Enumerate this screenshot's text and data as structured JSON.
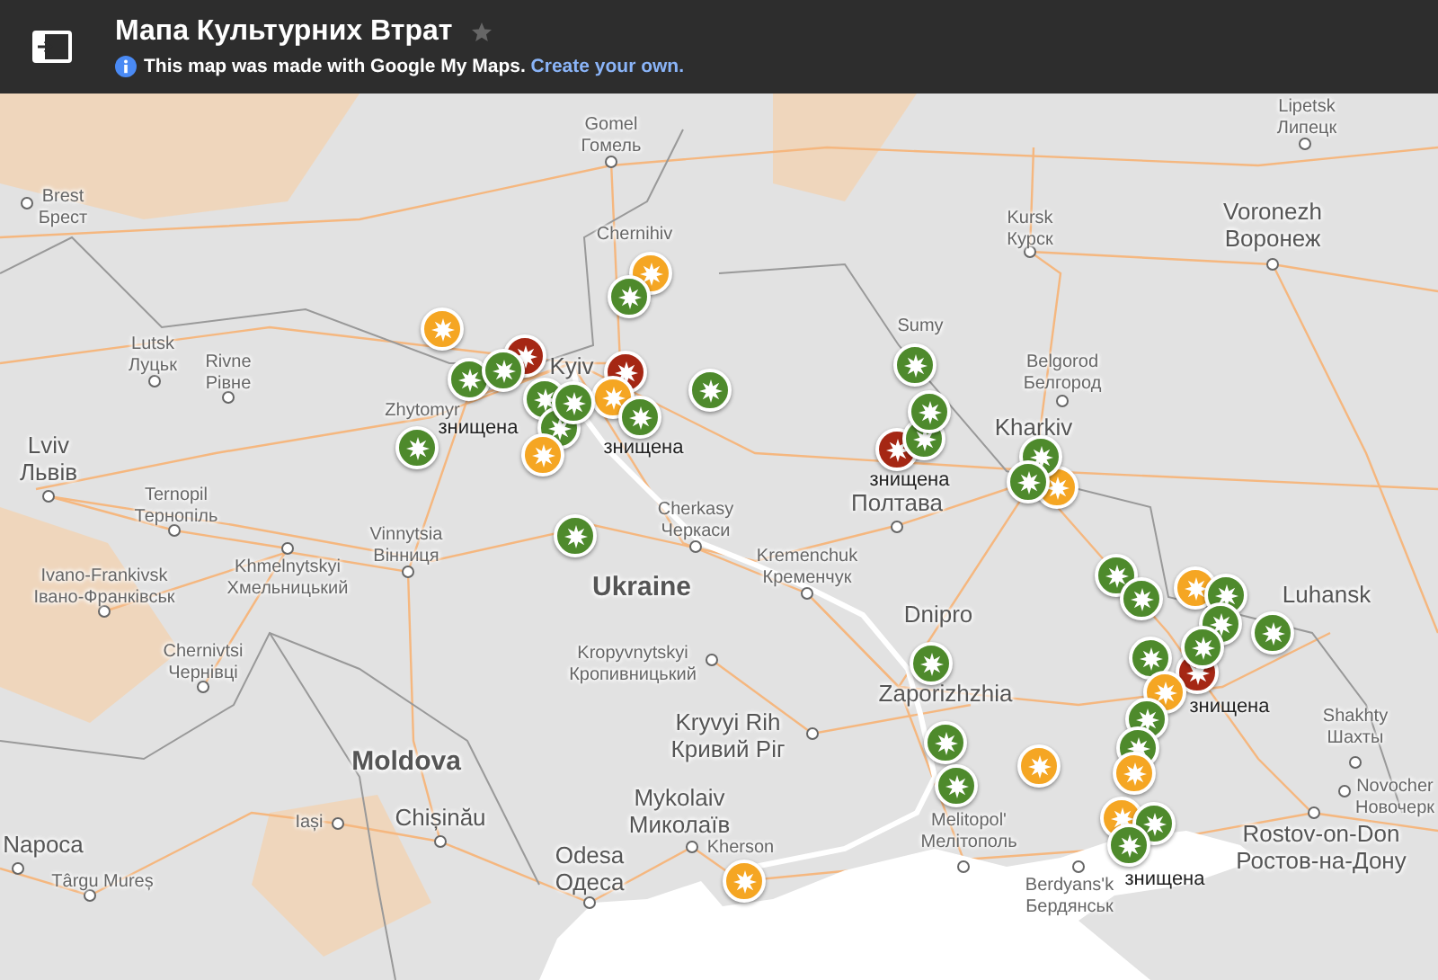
{
  "header": {
    "title": "Мапа Культурних Втрат",
    "info": "This map was made with Google My Maps.",
    "link": "Create your own."
  },
  "places": [
    {
      "name": "Gomel",
      "local": "Гомель",
      "kind": "city"
    },
    {
      "name": "Lipetsk",
      "local": "Липецк",
      "kind": "city"
    },
    {
      "name": "Brest",
      "local": "Брест",
      "kind": "city"
    },
    {
      "name": "Chernihiv",
      "kind": "city"
    },
    {
      "name": "Kursk",
      "local": "Курск",
      "kind": "city"
    },
    {
      "name": "Voronezh",
      "local": "Воронеж",
      "kind": "major"
    },
    {
      "name": "Lutsk",
      "local": "Луцьк",
      "kind": "city"
    },
    {
      "name": "Rivne",
      "local": "Рівне",
      "kind": "city"
    },
    {
      "name": "Kyiv",
      "kind": "major"
    },
    {
      "name": "Sumy",
      "kind": "city"
    },
    {
      "name": "Belgorod",
      "local": "Белгород",
      "kind": "city"
    },
    {
      "name": "Zhytomyr",
      "kind": "city"
    },
    {
      "name": "Kharkiv",
      "kind": "major"
    },
    {
      "name": "Lviv",
      "local": "Львів",
      "kind": "major"
    },
    {
      "name": "Ternopil",
      "local": "Тернопіль",
      "kind": "city"
    },
    {
      "name": "Cherkasy",
      "local": "Черкаси",
      "kind": "city"
    },
    {
      "name": "Полтава",
      "kind": "major"
    },
    {
      "name": "Vinnytsia",
      "local": "Вінниця",
      "kind": "city"
    },
    {
      "name": "Khmelnytskyi",
      "local": "Хмельницький",
      "kind": "city"
    },
    {
      "name": "Kremenchuk",
      "local": "Кременчук",
      "kind": "city"
    },
    {
      "name": "Ivano-Frankivsk",
      "local": "Івано-Франківськ",
      "kind": "city"
    },
    {
      "name": "Ukraine",
      "kind": "country"
    },
    {
      "name": "Dnipro",
      "kind": "major"
    },
    {
      "name": "Luhansk",
      "kind": "major"
    },
    {
      "name": "Chernivtsi",
      "local": "Чернівці",
      "kind": "city"
    },
    {
      "name": "Kropyvnytskyi",
      "local": "Кропивницький",
      "kind": "city"
    },
    {
      "name": "Zaporizhzhia",
      "kind": "major"
    },
    {
      "name": "Kryvyi Rih",
      "local": "Кривий Ріг",
      "kind": "major"
    },
    {
      "name": "Shakhty",
      "local": "Шахты",
      "kind": "city"
    },
    {
      "name": "Moldova",
      "kind": "country"
    },
    {
      "name": "Napoca",
      "kind": "major"
    },
    {
      "name": "Iași",
      "kind": "city"
    },
    {
      "name": "Chișinău",
      "kind": "major"
    },
    {
      "name": "Odesa",
      "local": "Одеса",
      "kind": "major"
    },
    {
      "name": "Mykolaiv",
      "local": "Миколаїв",
      "kind": "major"
    },
    {
      "name": "Kherson",
      "kind": "city"
    },
    {
      "name": "Melitopol'",
      "local": "Мелітополь",
      "kind": "city"
    },
    {
      "name": "Novocher",
      "local": "Новочерк",
      "kind": "city"
    },
    {
      "name": "Rostov-on-Don",
      "local": "Ростов-на-Дону",
      "kind": "major"
    },
    {
      "name": "Târgu Mureș",
      "kind": "city"
    },
    {
      "name": "Berdyans'k",
      "local": "Бердянськ",
      "kind": "city"
    }
  ],
  "pins": [
    {
      "color": "#f5a623"
    },
    {
      "color": "#a52714"
    },
    {
      "color": "#4e8a2c"
    },
    {
      "color": "#4e8a2c"
    },
    {
      "color": "#f5a623"
    },
    {
      "color": "#4e8a2c"
    },
    {
      "color": "#a52714"
    },
    {
      "color": "#f5a623"
    },
    {
      "color": "#4e8a2c"
    },
    {
      "color": "#4e8a2c"
    },
    {
      "color": "#4e8a2c"
    },
    {
      "color": "#f5a623"
    },
    {
      "color": "#4e8a2c"
    },
    {
      "color": "#4e8a2c"
    },
    {
      "color": "#4e8a2c"
    },
    {
      "color": "#4e8a2c"
    },
    {
      "color": "#4e8a2c"
    },
    {
      "color": "#a52714"
    },
    {
      "color": "#4e8a2c"
    },
    {
      "color": "#4e8a2c"
    },
    {
      "color": "#f5a623"
    },
    {
      "color": "#4e8a2c"
    },
    {
      "color": "#4e8a2c"
    },
    {
      "color": "#4e8a2c"
    },
    {
      "color": "#4e8a2c"
    },
    {
      "color": "#f5a623"
    },
    {
      "color": "#4e8a2c"
    },
    {
      "color": "#4e8a2c"
    },
    {
      "color": "#4e8a2c"
    },
    {
      "color": "#a52714"
    },
    {
      "color": "#4e8a2c"
    },
    {
      "color": "#4e8a2c"
    },
    {
      "color": "#f5a623"
    },
    {
      "color": "#4e8a2c"
    },
    {
      "color": "#4e8a2c"
    },
    {
      "color": "#4e8a2c"
    },
    {
      "color": "#4e8a2c"
    },
    {
      "color": "#4e8a2c"
    },
    {
      "color": "#f5a623"
    },
    {
      "color": "#f5a623"
    },
    {
      "color": "#f5a623"
    },
    {
      "color": "#4e8a2c"
    },
    {
      "color": "#4e8a2c"
    },
    {
      "color": "#f5a623"
    }
  ],
  "pin_captions": [
    "знищена",
    "знищена",
    "знищена",
    "знищена",
    "знищена"
  ]
}
